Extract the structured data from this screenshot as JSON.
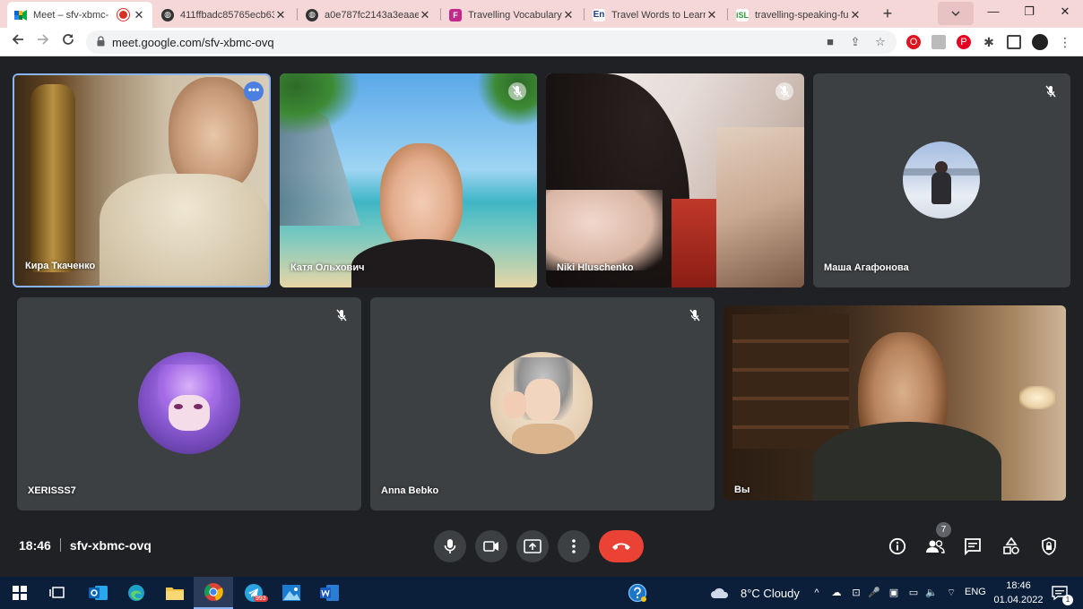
{
  "browser": {
    "tabs": [
      {
        "title": "Meet – sfv-xbmc-",
        "active": true,
        "recording": true
      },
      {
        "title": "411ffbadc85765ecb63"
      },
      {
        "title": "a0e787fc2143a3eaaec"
      },
      {
        "title": "Travelling Vocabulary"
      },
      {
        "title": "Travel Words to Learn"
      },
      {
        "title": "travelling-speaking-fu"
      }
    ],
    "url": "meet.google.com/sfv-xbmc-ovq",
    "new_tab": "+",
    "window": {
      "minimize": "—",
      "restore": "❐",
      "close": "✕"
    }
  },
  "meet": {
    "participants": [
      {
        "name": "Кира Ткаченко",
        "video": true,
        "active_speaker": true
      },
      {
        "name": "Катя Ольхович",
        "video": true,
        "muted": true
      },
      {
        "name": "Niki Hluschenko",
        "video": true,
        "muted": true
      },
      {
        "name": "Маша Агафонова",
        "video": false,
        "muted": true
      },
      {
        "name": "XERISSS7",
        "video": false,
        "muted": true
      },
      {
        "name": "Anna Bebko",
        "video": false,
        "muted": true
      },
      {
        "name": "Вы",
        "video": true
      }
    ],
    "time": "18:46",
    "meeting_code": "sfv-xbmc-ovq",
    "people_count": "7",
    "colors": {
      "hangup": "#ea4335",
      "active_border": "#8ab4f8",
      "tile_bg": "#3c4043"
    }
  },
  "taskbar": {
    "weather": "8°C  Cloudy",
    "language": "ENG",
    "clock_time": "18:46",
    "clock_date": "01.04.2022",
    "telegram_badge": "993",
    "notifications_badge": "1"
  }
}
